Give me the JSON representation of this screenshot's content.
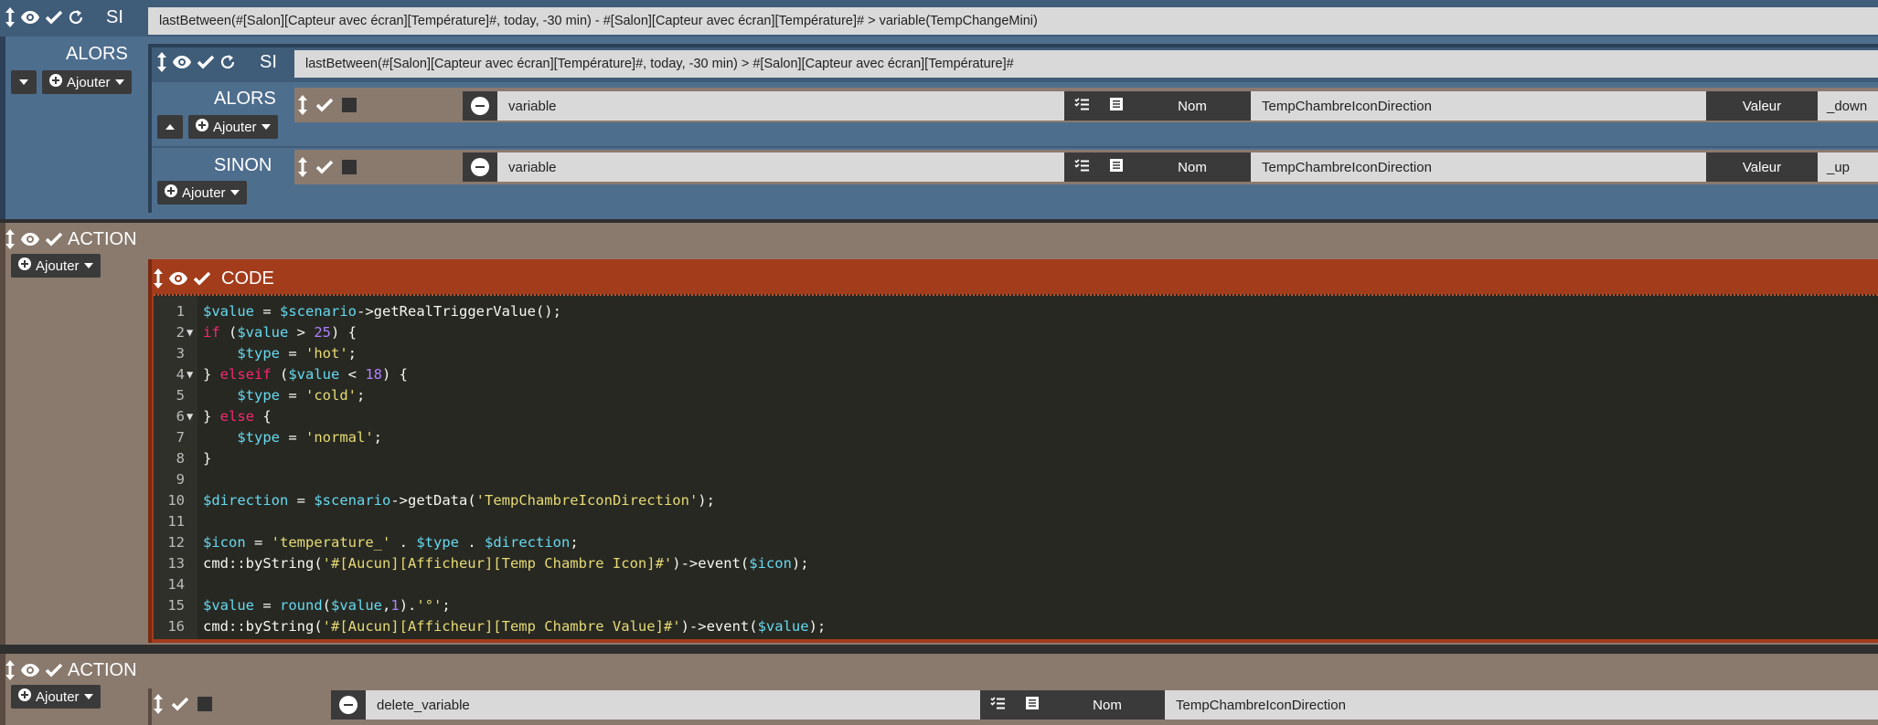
{
  "block1": {
    "si_label": "SI",
    "condition": "lastBetween(#[Salon][Capteur avec écran][Température]#, today, -30 min) - #[Salon][Capteur avec écran][Température]# > variable(TempChangeMini)",
    "alors_label": "ALORS",
    "ajouter_label": "Ajouter",
    "inner": {
      "si_label": "SI",
      "condition": "lastBetween(#[Salon][Capteur avec écran][Température]#, today, -30 min) > #[Salon][Capteur avec écran][Température]#",
      "alors_label": "ALORS",
      "ajouter_label": "Ajouter",
      "sinon_label": "SINON",
      "sinon_ajouter_label": "Ajouter",
      "alors_action": {
        "type": "variable",
        "nom_label": "Nom",
        "nom_value": "TempChambreIconDirection",
        "valeur_label": "Valeur",
        "valeur_value": "_down"
      },
      "sinon_action": {
        "type": "variable",
        "nom_label": "Nom",
        "nom_value": "TempChambreIconDirection",
        "valeur_label": "Valeur",
        "valeur_value": "_up"
      }
    }
  },
  "block2": {
    "action_label": "ACTION",
    "ajouter_label": "Ajouter",
    "code_label": "CODE",
    "line_numbers": [
      "1",
      "2",
      "3",
      "4",
      "5",
      "6",
      "7",
      "8",
      "9",
      "10",
      "11",
      "12",
      "13",
      "14",
      "15",
      "16"
    ]
  },
  "block3": {
    "action_label": "ACTION",
    "ajouter_label": "Ajouter",
    "action": {
      "type": "delete_variable",
      "nom_label": "Nom",
      "nom_value": "TempChambreIconDirection"
    }
  },
  "colors": {
    "si_block": "#4e6e8e",
    "action_block": "#8a7a6e",
    "code_header": "#a33c1b",
    "code_bg": "#272822"
  }
}
